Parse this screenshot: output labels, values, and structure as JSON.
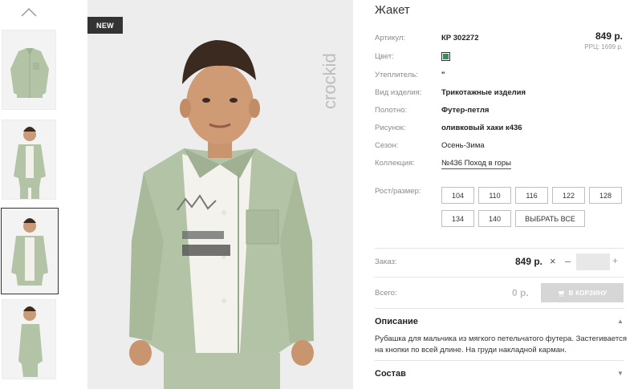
{
  "badge": "NEW",
  "brand": "crockid",
  "product": {
    "title": "Жакет",
    "price": "849 р.",
    "rrc": "РРЦ: 1699 р.",
    "color_hex": "#3c8f5b",
    "attributes": [
      {
        "label": "Артикул:",
        "value": "КР 302272"
      },
      {
        "label": "Цвет:",
        "value": ""
      },
      {
        "label": "Утеплитель:",
        "value": "\""
      },
      {
        "label": "Вид изделия:",
        "value": "Трикотажные изделия"
      },
      {
        "label": "Полотно:",
        "value": "Футер-петля"
      },
      {
        "label": "Рисунок:",
        "value": "оливковый хаки к436"
      },
      {
        "label": "Сезон:",
        "value": "Осень-Зима"
      },
      {
        "label": "Коллекция:",
        "value": "№436 Поход в горы"
      }
    ],
    "size_label": "Рост/размер:",
    "sizes": [
      "104",
      "110",
      "116",
      "122",
      "128",
      "134",
      "140"
    ],
    "select_all": "ВЫБРАТЬ ВСЕ",
    "order_label": "Заказ:",
    "order_price": "849 р.",
    "total_label": "Всего:",
    "total_value": "0 р.",
    "cart_button": "В КОРЗИНУ",
    "description_title": "Описание",
    "description_text": "Рубашка для мальчика из мягкого петельчатого футера. Застегивается на кнопки по всей длине. На груди накладной карман.",
    "composition_title": "Состав"
  }
}
